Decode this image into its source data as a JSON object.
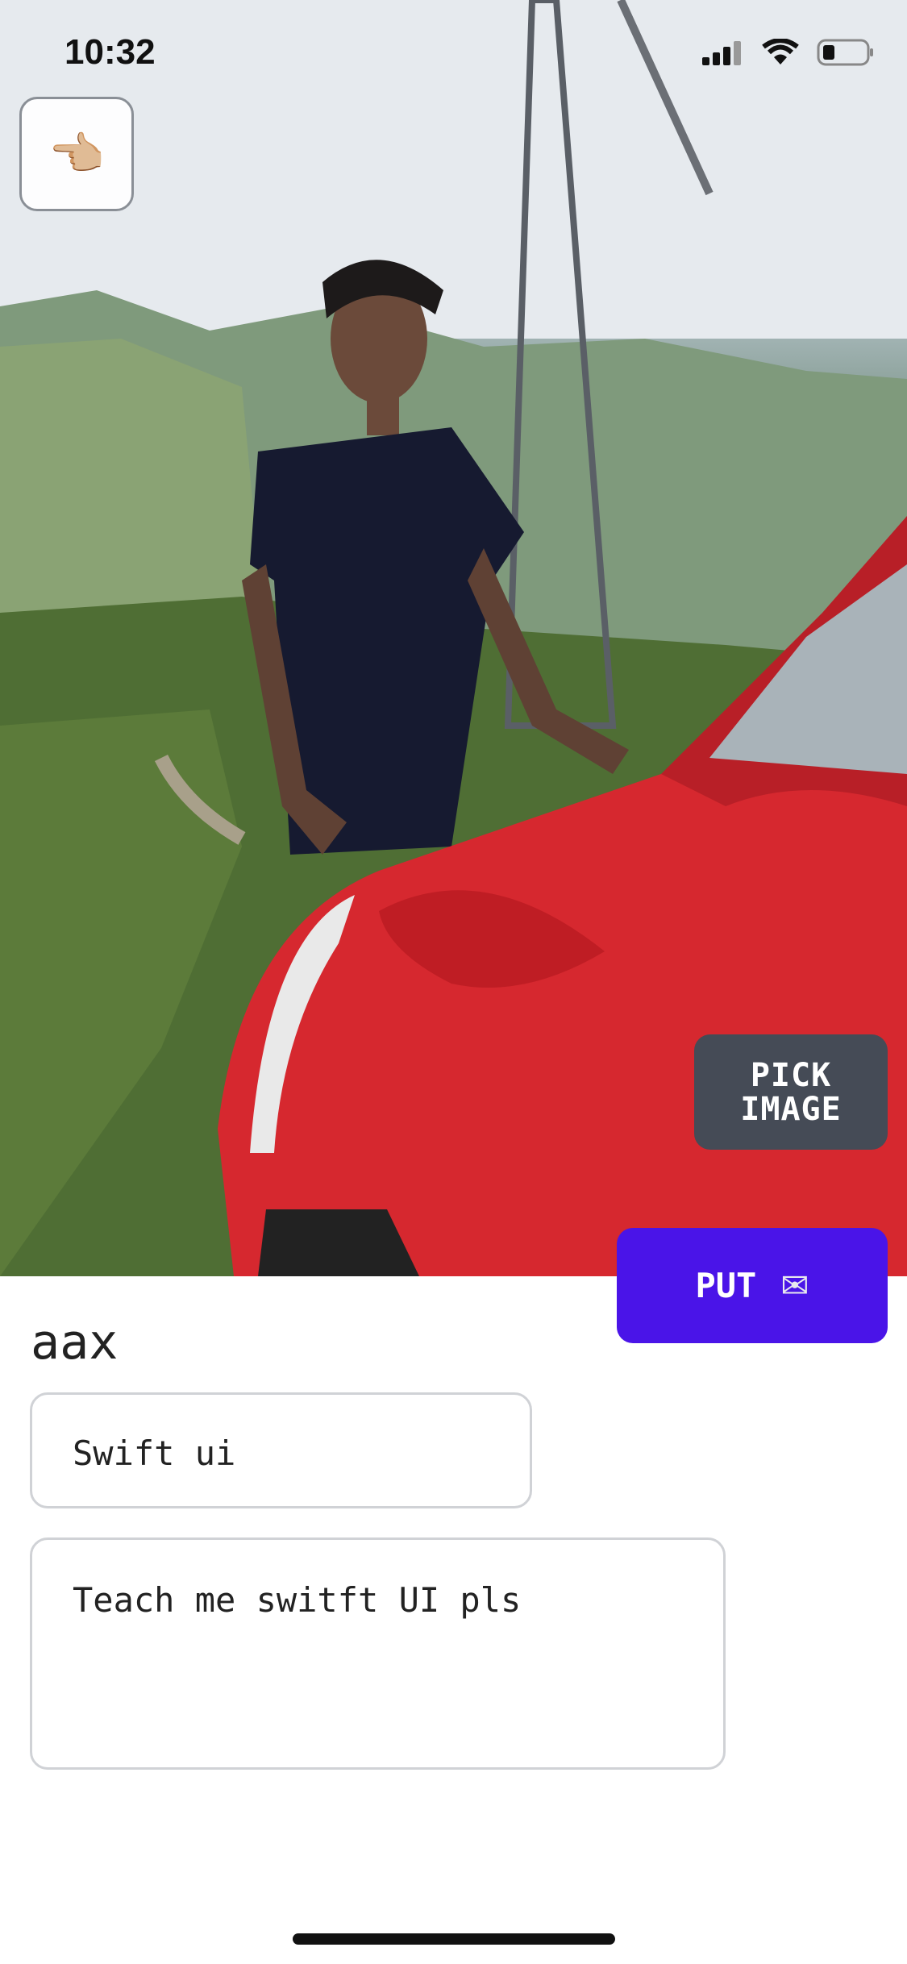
{
  "status_bar": {
    "time": "10:32"
  },
  "back_button": {
    "icon": "pointing-hand-icon",
    "glyph": "👈🏼"
  },
  "photo": {
    "description_name": "selected-photo"
  },
  "pick_image_button": {
    "line1": "PICK",
    "line2": "IMAGE"
  },
  "put_button": {
    "label": "PUT",
    "icon": "envelope-icon",
    "glyph": "✉"
  },
  "form": {
    "name": "aax",
    "title_value": "Swift ui",
    "body_value": "Teach me switft UI pls"
  },
  "colors": {
    "accent": "#4a14e8",
    "pick_bg": "#454b56"
  }
}
